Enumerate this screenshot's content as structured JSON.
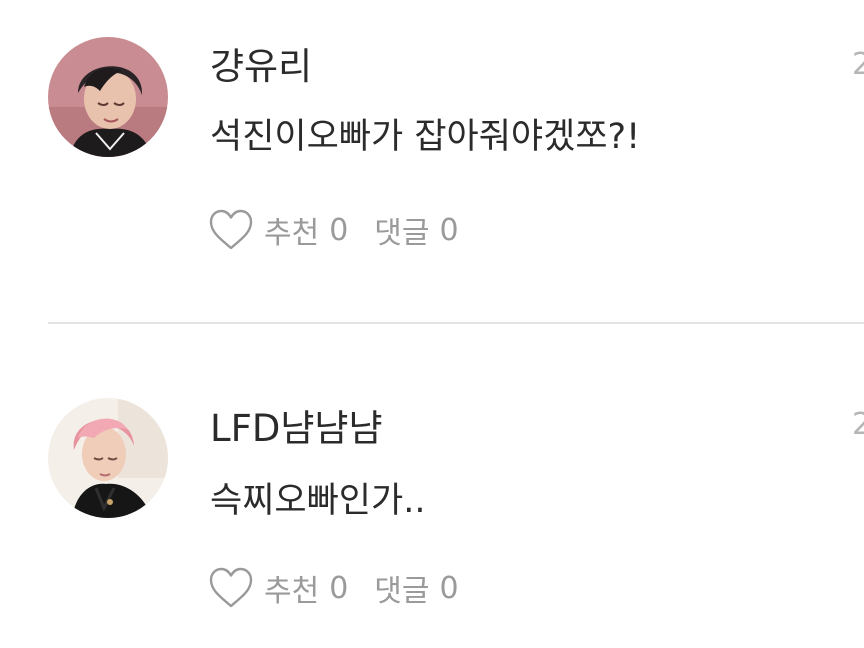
{
  "comments": [
    {
      "username": "걍유리",
      "text": "석진이오빠가 잡아줘야겠쪼?!",
      "timestamp": "2",
      "like_label": "추천",
      "like_count": "0",
      "reply_label": "댓글",
      "reply_count": "0"
    },
    {
      "username": "LFD냠냠냠",
      "text": "슥찌오빠인가..",
      "timestamp": "2",
      "like_label": "추천",
      "like_count": "0",
      "reply_label": "댓글",
      "reply_count": "0"
    }
  ],
  "icons": {
    "like": "heart-outline-icon"
  },
  "colors": {
    "text_primary": "#2b2b2b",
    "text_secondary": "#9a9a9a",
    "timestamp": "#b5b5b5",
    "divider": "#e4e4e4"
  }
}
